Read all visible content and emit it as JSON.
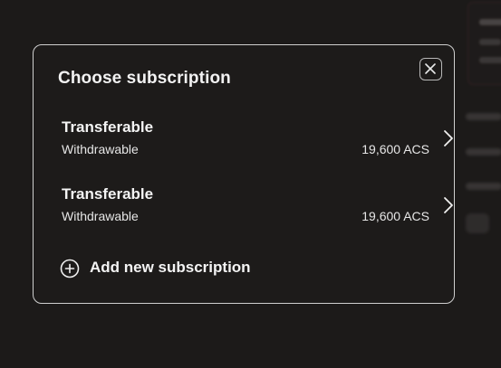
{
  "modal": {
    "title": "Choose subscription",
    "close_icon": "close-icon"
  },
  "options": [
    {
      "title": "Transferable",
      "subtitle": "Withdrawable",
      "amount": "19,600 ACS",
      "icon": "chevron-right-icon"
    },
    {
      "title": "Transferable",
      "subtitle": "Withdrawable",
      "amount": "19,600 ACS",
      "icon": "chevron-right-icon"
    }
  ],
  "add_action": {
    "label": "Add new subscription",
    "icon": "plus-circle-icon"
  },
  "colors": {
    "background": "#1c1a19",
    "modal_background": "#1d1b1a",
    "modal_border": "#cfcfcf",
    "text": "#f2f2f2",
    "background_accent_border": "#3a2426"
  }
}
